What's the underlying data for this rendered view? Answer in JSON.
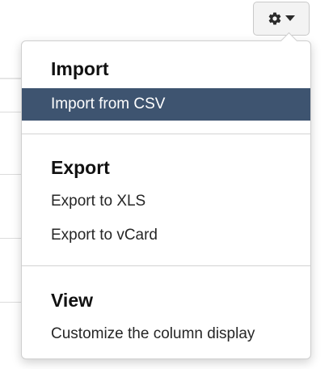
{
  "toolbar": {
    "gear_icon": "gear-icon",
    "caret_icon": "caret-down-icon"
  },
  "menu": {
    "sections": [
      {
        "header": "Import",
        "items": [
          {
            "label": "Import from CSV",
            "active": true
          }
        ]
      },
      {
        "header": "Export",
        "items": [
          {
            "label": "Export to XLS",
            "active": false
          },
          {
            "label": "Export to vCard",
            "active": false
          }
        ]
      },
      {
        "header": "View",
        "items": [
          {
            "label": "Customize the column display",
            "active": false
          }
        ]
      }
    ]
  },
  "colors": {
    "active_bg": "#3e5470",
    "active_text": "#ffffff",
    "divider": "#d3d3d3"
  }
}
